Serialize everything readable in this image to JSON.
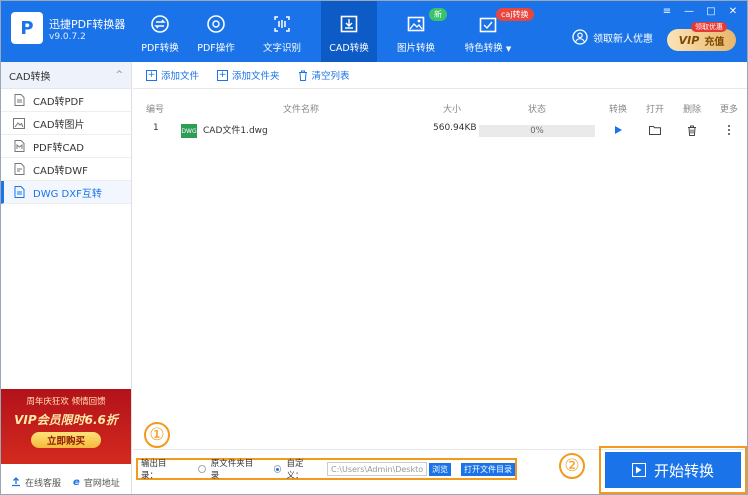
{
  "app": {
    "name": "迅捷PDF转换器",
    "version": "v9.0.7.2",
    "logo_glyph": "P"
  },
  "nav": [
    {
      "label": "PDF转换",
      "icon": "pdf-convert-icon"
    },
    {
      "label": "PDF操作",
      "icon": "pdf-ops-icon"
    },
    {
      "label": "文字识别",
      "icon": "ocr-icon"
    },
    {
      "label": "CAD转换",
      "icon": "cad-convert-icon",
      "active": true
    },
    {
      "label": "图片转换",
      "icon": "image-convert-icon",
      "badge": "新"
    },
    {
      "label": "特色转换",
      "icon": "special-convert-icon",
      "badge": "caj转换",
      "dropdown": "▼"
    }
  ],
  "header_right": {
    "login_label": "领取新人优惠",
    "vip_label": "VIP",
    "vip_suffix": "充值",
    "vip_tag": "领取优惠"
  },
  "window_controls": [
    "≡",
    "—",
    "□",
    "✕"
  ],
  "sidebar": {
    "header": "CAD转换",
    "collapse_glyph": "^",
    "items": [
      {
        "label": "CAD转PDF",
        "icon": "file-pdf-icon"
      },
      {
        "label": "CAD转图片",
        "icon": "file-image-icon"
      },
      {
        "label": "PDF转CAD",
        "icon": "file-cad-icon"
      },
      {
        "label": "CAD转DWF",
        "icon": "file-dwf-icon"
      },
      {
        "label": "DWG DXF互转",
        "icon": "file-dwg-icon",
        "active": true
      }
    ],
    "promo": {
      "line1": "周年庆狂欢 倾情回馈",
      "line2": "VIP会员限时6.6折",
      "button": "立即购买"
    },
    "footer": {
      "service": "在线客服",
      "website": "官网地址"
    }
  },
  "toolbar": {
    "add_file": "添加文件",
    "add_folder": "添加文件夹",
    "clear_list": "清空列表"
  },
  "table": {
    "columns": [
      "编号",
      "文件名称",
      "大小",
      "状态",
      "转换",
      "打开",
      "删除",
      "更多"
    ],
    "rows": [
      {
        "index": "1",
        "filename": "CAD文件1.dwg",
        "size": "560.94KB",
        "status": "0%",
        "progress": 0,
        "file_badge": "DWG"
      }
    ]
  },
  "bottom": {
    "step1": "①",
    "step2": "②",
    "output_label": "输出目录：",
    "option_original": "原文件夹目录",
    "option_custom": "自定义：",
    "path_value": "C:\\Users\\Admin\\Desktop",
    "browse": "浏览",
    "open_dir": "打开文件目录",
    "start_button": "开始转换"
  },
  "colors": {
    "brand": "#1a73e8",
    "highlight": "#f39a1e",
    "promo": "#c91d1d"
  }
}
